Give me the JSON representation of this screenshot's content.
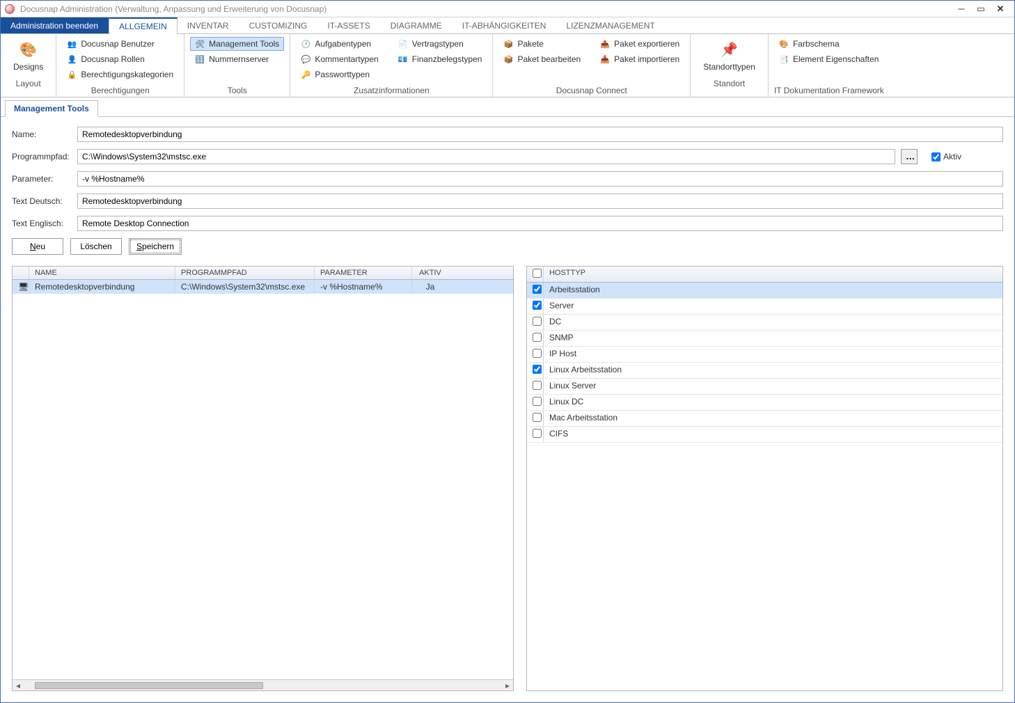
{
  "window": {
    "title": "Docusnap Administration (Verwaltung, Anpassung und Erweiterung von Docusnap)"
  },
  "mainTabs": {
    "primary": "Administration beenden",
    "items": [
      "ALLGEMEIN",
      "INVENTAR",
      "CUSTOMIZING",
      "IT-ASSETS",
      "DIAGRAMME",
      "IT-ABHÄNGIGKEITEN",
      "LIZENZMANAGEMENT"
    ],
    "activeIndex": 0
  },
  "ribbon": {
    "layout": {
      "designs": "Designs",
      "groupLabel": "Layout"
    },
    "permissions": {
      "items": [
        "Docusnap Benutzer",
        "Docusnap Rollen",
        "Berechtigungskategorien"
      ],
      "groupLabel": "Berechtigungen"
    },
    "tools": {
      "items": [
        "Management Tools",
        "Nummernserver"
      ],
      "groupLabel": "Tools",
      "selected": "Management Tools"
    },
    "zusatz": {
      "col1": [
        "Aufgabentypen",
        "Kommentartypen",
        "Passworttypen"
      ],
      "col2": [
        "Vertragstypen",
        "Finanzbelegstypen"
      ],
      "groupLabel": "Zusatzinformationen"
    },
    "connect": {
      "col1": [
        "Pakete",
        "Paket bearbeiten"
      ],
      "col2": [
        "Paket exportieren",
        "Paket importieren"
      ],
      "groupLabel": "Docusnap Connect"
    },
    "standort": {
      "label": "Standorttypen",
      "groupLabel": "Standort"
    },
    "framework": {
      "items": [
        "Farbschema",
        "Element Eigenschaften"
      ],
      "groupLabel": "IT Dokumentation Framework"
    }
  },
  "panel": {
    "tab": "Management Tools"
  },
  "form": {
    "labels": {
      "name": "Name:",
      "programmpfad": "Programmpfad:",
      "parameter": "Parameter:",
      "textDeutsch": "Text Deutsch:",
      "textEnglisch": "Text Englisch:",
      "aktiv": "Aktiv"
    },
    "values": {
      "name": "Remotedesktopverbindung",
      "programmpfad": "C:\\Windows\\System32\\mstsc.exe",
      "parameter": "-v %Hostname%",
      "textDeutsch": "Remotedesktopverbindung",
      "textEnglisch": "Remote Desktop Connection",
      "aktivChecked": true
    },
    "buttons": {
      "neu": "Neu",
      "loeschen": "Löschen",
      "speichern": "Speichern"
    }
  },
  "leftGrid": {
    "headers": {
      "name": "NAME",
      "programmpfad": "PROGRAMMPFAD",
      "parameter": "PARAMETER",
      "aktiv": "AKTIV"
    },
    "rows": [
      {
        "name": "Remotedesktopverbindung",
        "programmpfad": "C:\\Windows\\System32\\mstsc.exe",
        "parameter": "-v %Hostname%",
        "aktiv": "Ja"
      }
    ]
  },
  "rightGrid": {
    "header": "HOSTTYP",
    "rows": [
      {
        "label": "Arbeitsstation",
        "checked": true
      },
      {
        "label": "Server",
        "checked": true
      },
      {
        "label": "DC",
        "checked": false
      },
      {
        "label": "SNMP",
        "checked": false
      },
      {
        "label": "IP Host",
        "checked": false
      },
      {
        "label": "Linux Arbeitsstation",
        "checked": true
      },
      {
        "label": "Linux Server",
        "checked": false
      },
      {
        "label": "Linux DC",
        "checked": false
      },
      {
        "label": "Mac Arbeitsstation",
        "checked": false
      },
      {
        "label": "CIFS",
        "checked": false
      }
    ]
  }
}
